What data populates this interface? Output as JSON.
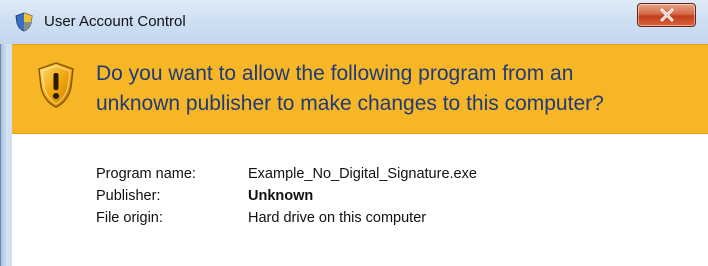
{
  "window": {
    "title": "User Account Control",
    "close_label": "x"
  },
  "banner": {
    "line1": "Do you want to allow the following program from an",
    "line2": "unknown publisher to make changes to this computer?",
    "icon": "uac-warning-shield-icon"
  },
  "details": {
    "program_name_label": "Program name:",
    "program_name_value": "Example_No_Digital_Signature.exe",
    "publisher_label": "Publisher:",
    "publisher_value": "Unknown",
    "file_origin_label": "File origin:",
    "file_origin_value": "Hard drive on this computer"
  },
  "colors": {
    "banner": "#f7b626",
    "headline_text": "#1f3a78",
    "titlebar": "#cfe0f3",
    "close_button": "#c33b1c"
  }
}
